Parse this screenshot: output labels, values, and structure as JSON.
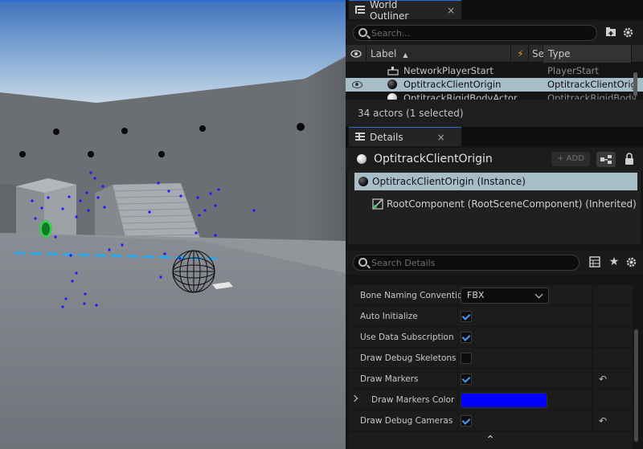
{
  "outliner": {
    "tab_label": "World Outliner",
    "close_glyph": "×",
    "search_placeholder": "Search...",
    "columns": {
      "label": "Label",
      "sort_indicator": "▲",
      "se": "Se",
      "type": "Type"
    },
    "rows": [
      {
        "label": "NetworkPlayerStart",
        "type": "PlayerStart",
        "icon": "player-start-icon",
        "selected": false
      },
      {
        "label": "OptitrackClientOrigin",
        "type": "OptitrackClientOrigin",
        "icon": "sphere-icon",
        "selected": true
      },
      {
        "label": "OptitrackRigidBodyActor",
        "type": "OptitrackRigidBodyA",
        "icon": "sphere-icon",
        "selected": false
      }
    ],
    "status": "34 actors (1 selected)"
  },
  "details": {
    "tab_label": "Details",
    "close_glyph": "×",
    "actor_name": "OptitrackClientOrigin",
    "add_label": "+ ADD",
    "components": [
      {
        "label": "OptitrackClientOrigin (Instance)",
        "selected": true
      },
      {
        "label": "RootComponent (RootSceneComponent) (Inherited)",
        "selected": false
      }
    ],
    "search_placeholder": "Search Details",
    "properties": {
      "bone_naming": {
        "label": "Bone Naming Convention",
        "value": "FBX"
      },
      "auto_initialize": {
        "label": "Auto Initialize",
        "checked": true
      },
      "use_data_subscription": {
        "label": "Use Data Subscription",
        "checked": true
      },
      "draw_debug_skeletons": {
        "label": "Draw Debug Skeletons",
        "checked": false
      },
      "draw_markers": {
        "label": "Draw Markers",
        "checked": true
      },
      "draw_markers_color": {
        "label": "Draw Markers Color",
        "color": "#0000ff"
      },
      "draw_debug_cameras": {
        "label": "Draw Debug Cameras",
        "checked": true
      }
    },
    "reset_glyph": "↶",
    "collapse_glyph": "⌃"
  },
  "colors": {
    "selection": "#a7bec9",
    "accent_tab": "#2b6cd6",
    "marker_blue": "#0000ff",
    "checkbox_tick": "#3aa0ff"
  }
}
